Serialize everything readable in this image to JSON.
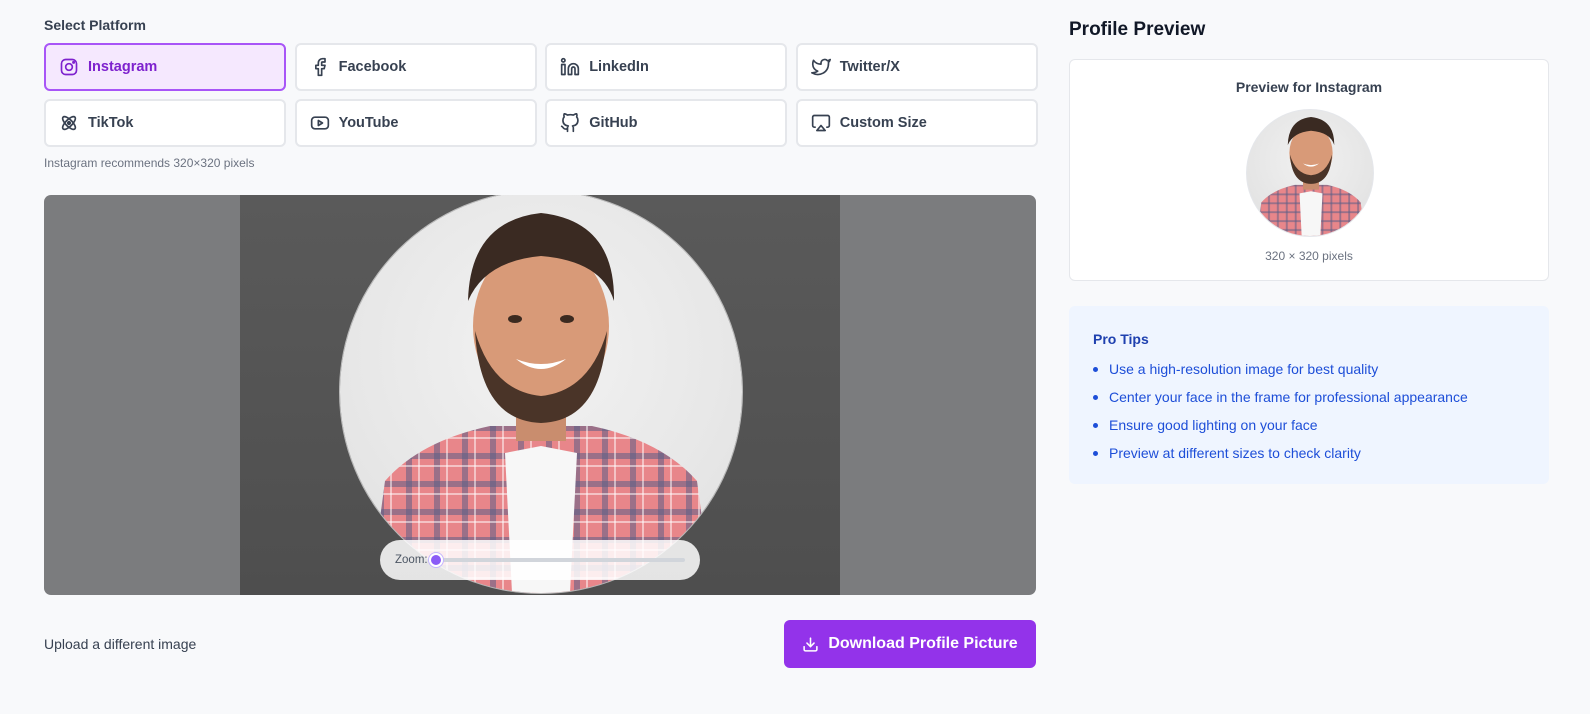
{
  "platform_section": {
    "label": "Select Platform",
    "recommendation": "Instagram recommends 320×320 pixels",
    "platforms": [
      {
        "label": "Instagram",
        "icon": "instagram-icon",
        "active": true
      },
      {
        "label": "Facebook",
        "icon": "facebook-icon",
        "active": false
      },
      {
        "label": "LinkedIn",
        "icon": "linkedin-icon",
        "active": false
      },
      {
        "label": "Twitter/X",
        "icon": "twitter-icon",
        "active": false
      },
      {
        "label": "TikTok",
        "icon": "tiktok-icon",
        "active": false
      },
      {
        "label": "YouTube",
        "icon": "youtube-icon",
        "active": false
      },
      {
        "label": "GitHub",
        "icon": "github-icon",
        "active": false
      },
      {
        "label": "Custom Size",
        "icon": "monitor-icon",
        "active": false
      }
    ]
  },
  "editor": {
    "zoom_label": "Zoom:",
    "zoom_level": 0.0
  },
  "actions": {
    "upload_label": "Upload a different image",
    "download_label": "Download Profile Picture"
  },
  "preview": {
    "title": "Profile Preview",
    "heading": "Preview for Instagram",
    "size_text": "320 × 320 pixels"
  },
  "tips": {
    "title": "Pro Tips",
    "items": [
      "Use a high-resolution image for best quality",
      "Center your face in the frame for professional appearance",
      "Ensure good lighting on your face",
      "Preview at different sizes to check clarity"
    ]
  },
  "colors": {
    "accent": "#9333ea",
    "active_bg": "#f5e8fe",
    "tips_bg": "#eff5ff",
    "tips_text": "#1d4ed8"
  }
}
